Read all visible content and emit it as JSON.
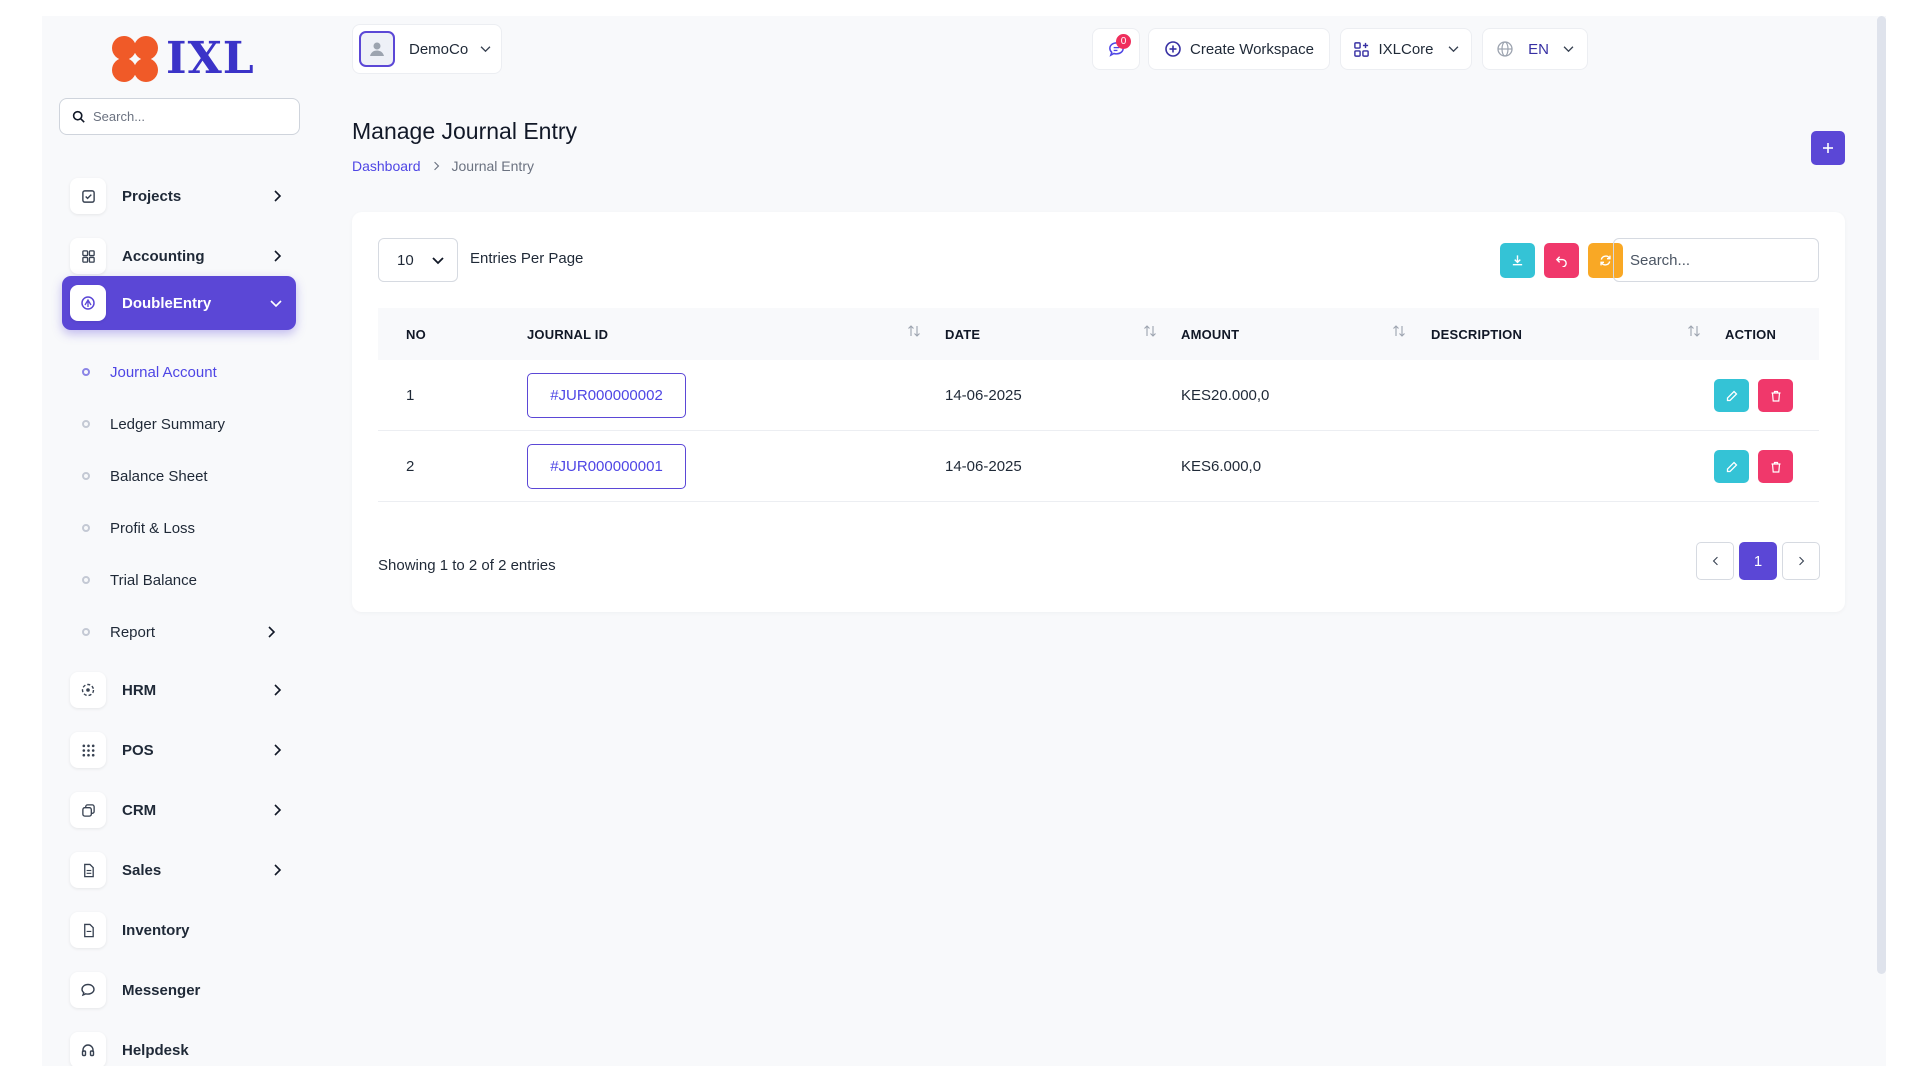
{
  "brand": {
    "logo_text": "IXL",
    "logo_color": "#f05a28",
    "text_color": "#3b33c8"
  },
  "sidebar": {
    "search_placeholder": "Search...",
    "items": [
      {
        "label": "Projects",
        "icon": "checkbox-icon"
      },
      {
        "label": "Accounting",
        "icon": "grid-icon"
      },
      {
        "label": "DoubleEntry",
        "icon": "scale-icon",
        "active": true
      },
      {
        "label": "HRM",
        "icon": "users-circle-icon"
      },
      {
        "label": "POS",
        "icon": "dots-grid-icon"
      },
      {
        "label": "CRM",
        "icon": "layers-icon"
      },
      {
        "label": "Sales",
        "icon": "document-icon"
      },
      {
        "label": "Inventory",
        "icon": "file-icon"
      },
      {
        "label": "Messenger",
        "icon": "chat-icon"
      },
      {
        "label": "Helpdesk",
        "icon": "headset-icon"
      }
    ],
    "subitems": [
      {
        "label": "Journal Account",
        "active": true
      },
      {
        "label": "Ledger Summary"
      },
      {
        "label": "Balance Sheet"
      },
      {
        "label": "Profit & Loss"
      },
      {
        "label": "Trial Balance"
      },
      {
        "label": "Report",
        "has_children": true
      }
    ]
  },
  "topbar": {
    "workspace": "DemoCo",
    "notifications_count": "0",
    "create_workspace": "Create Workspace",
    "core_menu": "IXLCore",
    "language": "EN"
  },
  "page": {
    "title": "Manage Journal Entry",
    "breadcrumb": [
      "Dashboard",
      "Journal Entry"
    ]
  },
  "table": {
    "per_page": "10",
    "per_page_label": "Entries Per Page",
    "search_placeholder": "Search...",
    "columns": [
      "NO",
      "JOURNAL ID",
      "DATE",
      "AMOUNT",
      "DESCRIPTION",
      "ACTION"
    ],
    "rows": [
      {
        "no": "1",
        "journal_id": "#JUR000000002",
        "date": "14-06-2025",
        "amount": "KES20.000,0",
        "description": ""
      },
      {
        "no": "2",
        "journal_id": "#JUR000000001",
        "date": "14-06-2025",
        "amount": "KES6.000,0",
        "description": ""
      }
    ],
    "showing": "Showing 1 to 2 of 2 entries",
    "current_page": "1"
  },
  "colors": {
    "primary": "#5b47d6",
    "info": "#34c3d6",
    "danger": "#f0386b",
    "warning": "#f9a825"
  }
}
